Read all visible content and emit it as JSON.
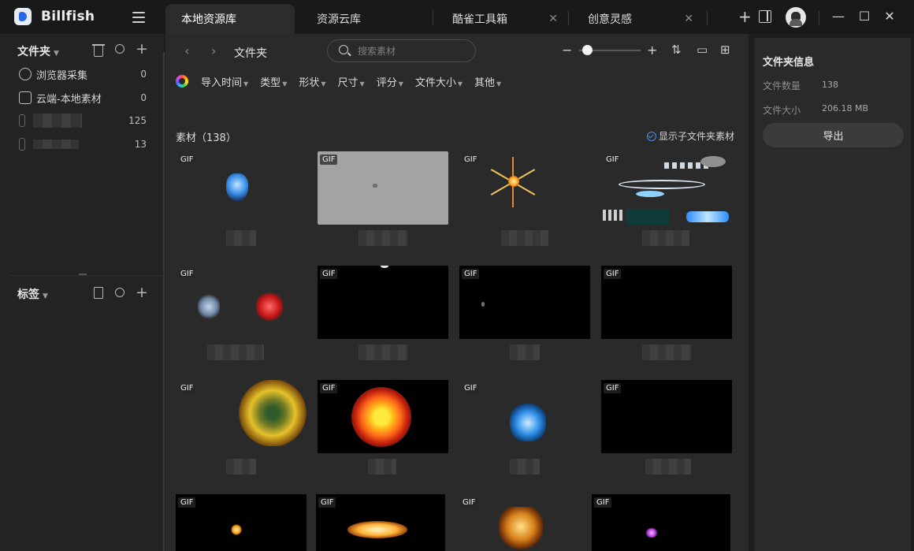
{
  "app": {
    "name": "Billfish"
  },
  "tabs": [
    {
      "label": "本地资源库",
      "active": true
    },
    {
      "label": "资源云库"
    },
    {
      "label": "酷雀工具箱"
    },
    {
      "label": "创意灵感"
    }
  ],
  "sidebar": {
    "folders_header": "文件夹",
    "items": [
      {
        "label": "浏览器采集",
        "count": "0",
        "icon": "compass-icon"
      },
      {
        "label": "云端-本地素材",
        "count": "0",
        "icon": "cloud-folder-icon"
      },
      {
        "label": "",
        "count": "125",
        "icon": "folder-icon"
      },
      {
        "label": "",
        "count": "13",
        "icon": "folder-icon"
      }
    ],
    "tags_header": "标签"
  },
  "toolbar": {
    "breadcrumb": "文件夹",
    "search_placeholder": "搜索素材",
    "zoom_level": 0.05
  },
  "filters": [
    "导入时间",
    "类型",
    "形状",
    "尺寸",
    "评分",
    "文件大小",
    "其他"
  ],
  "content": {
    "count_label": "素材（138）",
    "show_subfolder_label": "显示子文件夹素材",
    "badge": "GIF"
  },
  "info_panel": {
    "title": "文件夹信息",
    "count_label": "文件数量",
    "count_value": "138",
    "size_label": "文件大小",
    "size_value": "206.18 MB",
    "export_label": "导出"
  }
}
